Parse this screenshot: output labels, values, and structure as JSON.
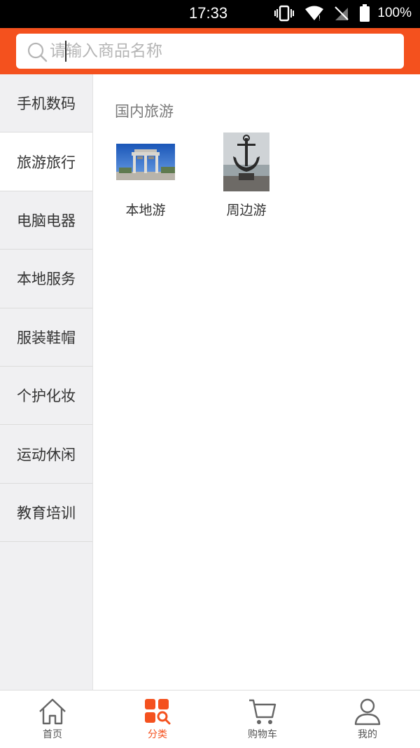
{
  "status": {
    "time": "17:33",
    "battery": "100%"
  },
  "search": {
    "placeholder": "请输入商品名称"
  },
  "sidebar": {
    "items": [
      {
        "label": "手机数码"
      },
      {
        "label": "旅游旅行"
      },
      {
        "label": "电脑电器"
      },
      {
        "label": "本地服务"
      },
      {
        "label": "服装鞋帽"
      },
      {
        "label": "个护化妆"
      },
      {
        "label": "运动休闲"
      },
      {
        "label": "教育培训"
      }
    ],
    "active_index": 1
  },
  "content": {
    "section_title": "国内旅游",
    "tiles": [
      {
        "label": "本地游",
        "image": "stone-archway-photo"
      },
      {
        "label": "周边游",
        "image": "anchor-sculpture-photo"
      }
    ]
  },
  "tabbar": {
    "items": [
      {
        "label": "首页",
        "icon": "home-icon"
      },
      {
        "label": "分类",
        "icon": "category-icon"
      },
      {
        "label": "购物车",
        "icon": "cart-icon"
      },
      {
        "label": "我的",
        "icon": "user-icon"
      }
    ],
    "active_index": 1
  },
  "colors": {
    "accent": "#f4511e",
    "sidebar_bg": "#f0f0f2"
  }
}
